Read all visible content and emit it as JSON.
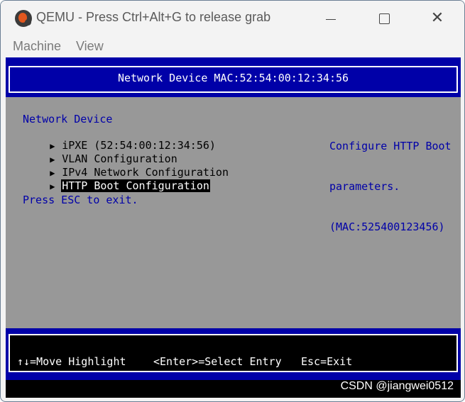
{
  "window": {
    "title": "QEMU - Press Ctrl+Alt+G to release grab"
  },
  "menubar": {
    "items": [
      "Machine",
      "View"
    ]
  },
  "bios": {
    "header": "Network Device MAC:52:54:00:12:34:56",
    "section_title": "Network Device",
    "entries": [
      {
        "label": "iPXE (52:54:00:12:34:56)",
        "selected": false
      },
      {
        "label": "VLAN Configuration",
        "selected": false
      },
      {
        "label": "IPv4 Network Configuration",
        "selected": false
      },
      {
        "label": "HTTP Boot Configuration",
        "selected": true
      }
    ],
    "entry_marker": "▶",
    "hint": "Press ESC to exit.",
    "help_lines": [
      "Configure HTTP Boot",
      "parameters.",
      "(MAC:525400123456)"
    ],
    "footer": {
      "move": "↑↓=Move Highlight",
      "select": "<Enter>=Select Entry",
      "exit": "Esc=Exit"
    }
  },
  "watermark": "CSDN @jiangwei0512",
  "colors": {
    "bios_blue": "#0000a8",
    "bios_gray": "#989898",
    "title_bar": "#f3f3f3"
  }
}
